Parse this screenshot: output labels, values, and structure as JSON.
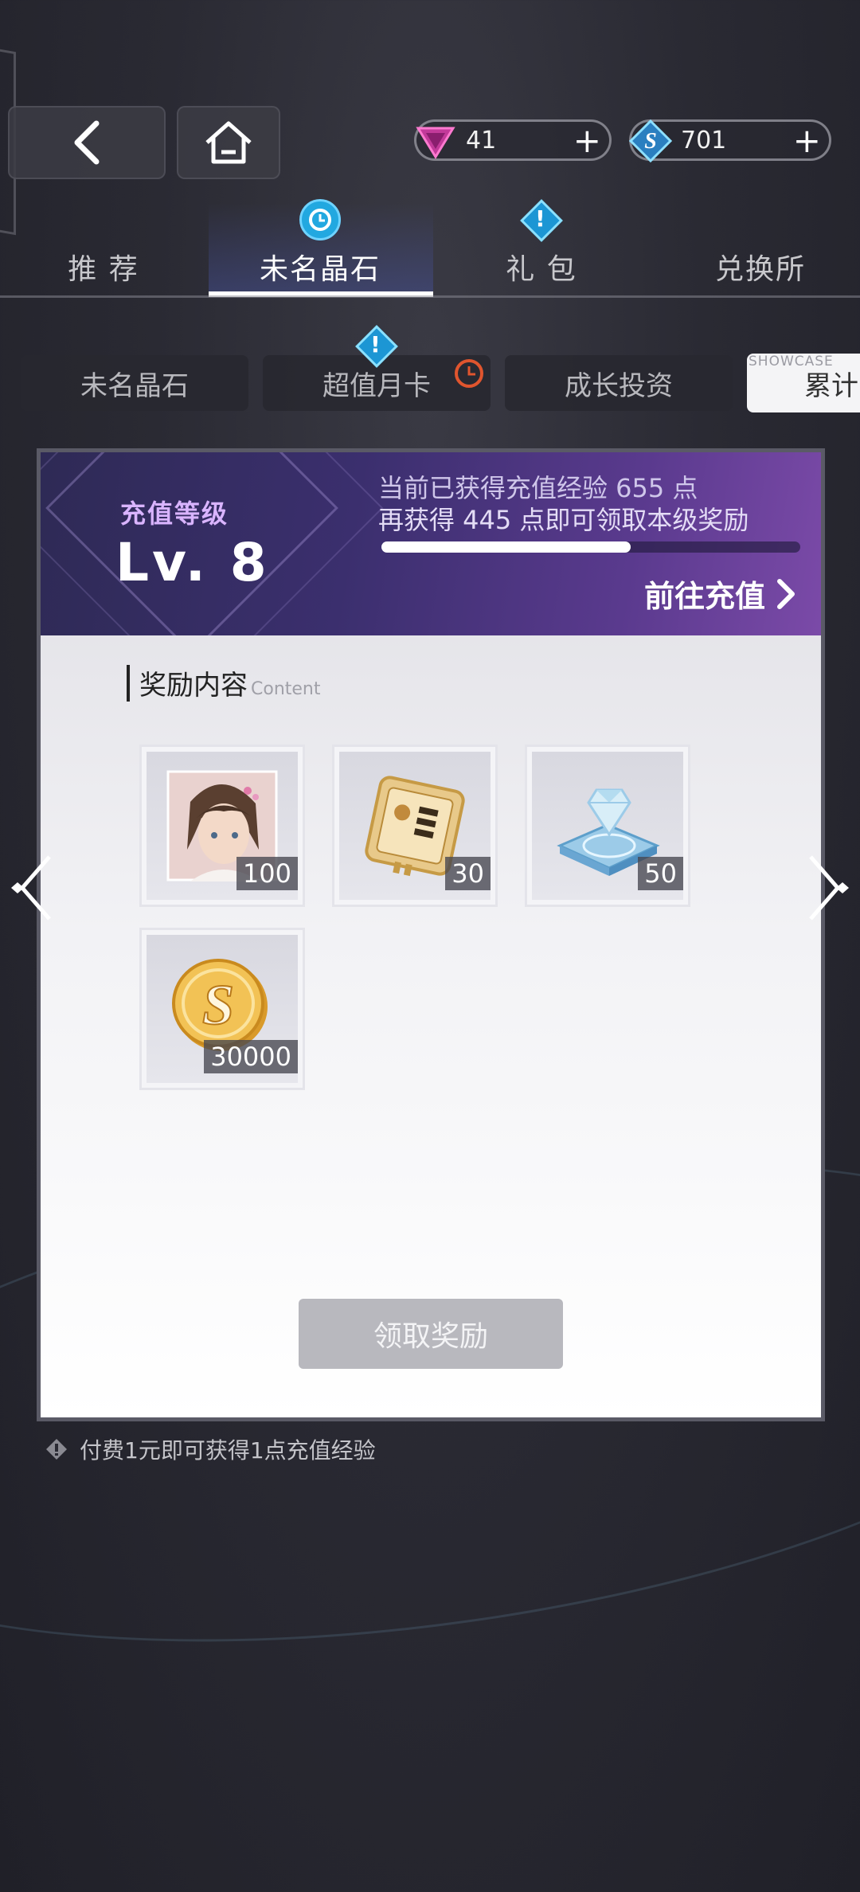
{
  "currency": [
    {
      "name": "crystal",
      "value": "41",
      "icon": "pink-triangle-crystal-icon"
    },
    {
      "name": "coin",
      "value": "701",
      "icon": "blue-s-coin-icon"
    }
  ],
  "tabs": [
    {
      "label": "推 荐",
      "active": false
    },
    {
      "label": "未名晶石",
      "active": true
    },
    {
      "label": "礼 包",
      "active": false
    },
    {
      "label": "兑换所",
      "active": false
    }
  ],
  "subtabs": [
    {
      "label": "未名晶石"
    },
    {
      "label": "超值月卡"
    },
    {
      "label": "成长投资"
    },
    {
      "label": "累计",
      "tag": "SHOWCASE"
    }
  ],
  "panel": {
    "level_title": "充值等级",
    "level_value": "Lv. 8",
    "exp_line1": "当前已获得充值经验 655 点",
    "exp_line2": "再获得 445 点即可领取本级奖励",
    "progress": 0.5954,
    "recharge_label": "前往充值",
    "section_title": "奖励内容",
    "section_sub": "Content",
    "rewards": [
      {
        "item": "character-portrait-card",
        "count": "100"
      },
      {
        "item": "gold-chip-card",
        "count": "30"
      },
      {
        "item": "blue-crystal-platform",
        "count": "50"
      },
      {
        "item": "gold-s-coin",
        "count": "30000"
      }
    ],
    "claim_label": "领取奖励"
  },
  "footnote": "付费1元即可获得1点充值经验",
  "colors": {
    "accent_blue": "#22a8e0",
    "header_purple": "#5a3a8e",
    "level_title": "#d9b4ff"
  }
}
